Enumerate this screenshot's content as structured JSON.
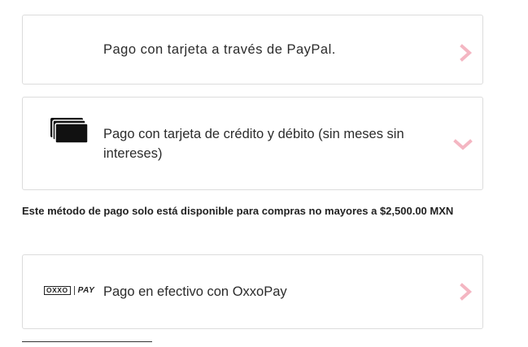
{
  "payment_options": {
    "paypal": {
      "label": "Pago con tarjeta a través de PayPal.",
      "icon": "chevron-right-icon"
    },
    "card": {
      "label": "Pago con tarjeta de crédito y débito (sin meses sin intereses)",
      "icon": "credit-cards-icon",
      "expanded": true
    },
    "oxxo": {
      "label": "Pago en efectivo con OxxoPay",
      "logo_left": "OXXO",
      "logo_right": "PAY",
      "icon": "chevron-right-icon"
    }
  },
  "notice": "Este método de pago solo está disponible para compras no mayores a $2,500.00 MXN",
  "colors": {
    "chevron": "#f4b6c2",
    "border": "#dcdcdc",
    "text": "#2b2b2b"
  }
}
